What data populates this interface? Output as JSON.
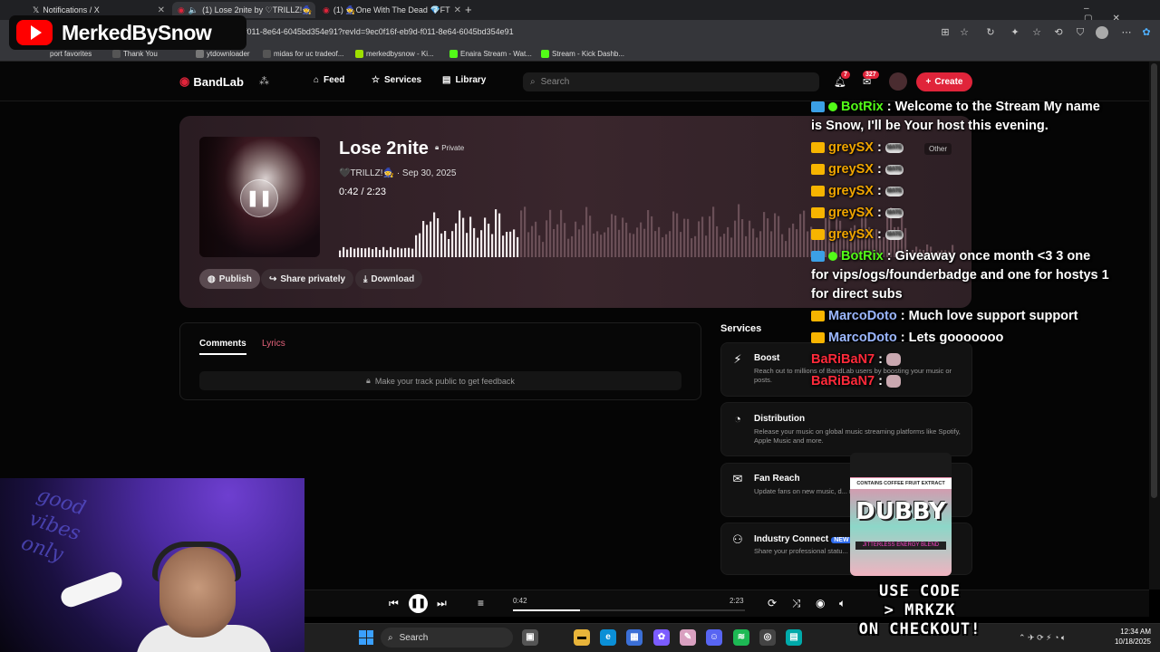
{
  "browser": {
    "tabs": [
      {
        "label": "Notifications / X"
      },
      {
        "label": "(1) Lose 2nite by ♡TRILLZ!🧙"
      },
      {
        "label": "(1) 🧙One With The Dead 💎FT"
      }
    ],
    "url": "f011-8e64-6045bd354e91?revId=9ec0f16f-eb9d-f011-8e64-6045bd354e91",
    "bookmarks": [
      {
        "label": "port favorites"
      },
      {
        "label": "Thank You"
      },
      {
        "label": "ytdownloader"
      },
      {
        "label": "midas for uc tradeof..."
      },
      {
        "label": "merkedbysnow - Ki..."
      },
      {
        "label": "Enaira Stream - Wat..."
      },
      {
        "label": "Stream - Kick Dashb..."
      }
    ]
  },
  "nav": {
    "brand": "BandLab",
    "links": [
      "Feed",
      "Services",
      "Library"
    ],
    "search_placeholder": "Search",
    "notif_count": "7",
    "msg_count": "327",
    "create_label": "Create"
  },
  "track": {
    "title": "Lose 2nite",
    "privacy": "Private",
    "artist": "🖤TRILLZ!🧙",
    "date": "· Sep 30, 2025",
    "position": "0:42",
    "duration": "/  2:23",
    "progress_fraction": 0.29,
    "actions": {
      "publish": "Publish",
      "share": "Share privately",
      "download": "Download"
    }
  },
  "comments": {
    "tabs": [
      "Comments",
      "Lyrics"
    ],
    "locked_message": "Make your track public to get feedback"
  },
  "services": {
    "title": "Services",
    "items": [
      {
        "name": "Boost",
        "desc": "Reach out to millions of BandLab users by boosting your music or posts."
      },
      {
        "name": "Distribution",
        "desc": "Release your music on global music streaming platforms like Spotify, Apple Music and more."
      },
      {
        "name": "Fan Reach",
        "desc": "Update fans on new music, d... reach out to connect."
      },
      {
        "name": "Industry Connect",
        "badge": "NEW",
        "desc": "Share your professional statu... representation, record deals"
      }
    ]
  },
  "player": {
    "current": "0:42",
    "total": "2:23"
  },
  "taskbar": {
    "search": "Search",
    "time": "12:34 AM",
    "date": "10/18/2025"
  },
  "overlay": {
    "channel": "MerkedBySnow",
    "chat": [
      {
        "user": "BotRix",
        "type": "bot",
        "text": " : Welcome to the Stream My name is Snow, I'll be Your host this evening."
      },
      {
        "user": "greySX",
        "type": "crown",
        "text": " : "
      },
      {
        "user": "greySX",
        "type": "crown",
        "text": " : "
      },
      {
        "user": "greySX",
        "type": "crown",
        "text": " : "
      },
      {
        "user": "greySX",
        "type": "crown",
        "text": " : "
      },
      {
        "user": "greySX",
        "type": "crown",
        "text": " : "
      },
      {
        "user": "BotRix",
        "type": "bot",
        "text": " : Giveaway once month <3 3 one for vips/ogs/founderbadge and one for hostys 1 for direct subs"
      },
      {
        "user": "MarcoDoto",
        "type": "crown",
        "text": " : Much love support support"
      },
      {
        "user": "MarcoDoto",
        "type": "crown",
        "text": " : Lets gooooooo"
      },
      {
        "user": "BaRiBaN7",
        "type": "plain",
        "text": " : "
      },
      {
        "user": "BaRiBaN7",
        "type": "plain",
        "text": " : "
      }
    ],
    "emote_label": "MATE",
    "other_label": "Other",
    "colors": {
      "bot": "#53fc18",
      "grey": "#f0a500",
      "marco": "#9bb7ff",
      "bari": "#ff2a3a"
    },
    "can": {
      "top": "CONTAINS COFFEE FRUIT EXTRACT",
      "brand": "DUBBY",
      "sub": "JITTERLESS ENERGY BLEND"
    },
    "promo": "USE CODE\n> MRKZK\nON CHECKOUT!",
    "cam_text": "good vibes only"
  }
}
